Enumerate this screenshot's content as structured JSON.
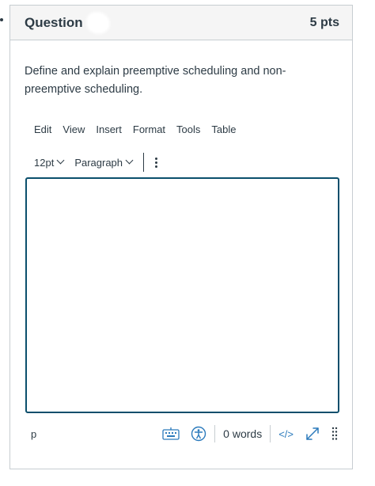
{
  "question": {
    "title": "Question",
    "points": "5 pts",
    "text": "Define and explain preemptive scheduling and non-preemptive scheduling."
  },
  "editor": {
    "menubar": [
      "Edit",
      "View",
      "Insert",
      "Format",
      "Tools",
      "Table"
    ],
    "toolbar": {
      "font_size": "12pt",
      "block_format": "Paragraph",
      "more_icon": "kebab-icon"
    },
    "content": "",
    "statusbar": {
      "path": "p",
      "word_count": "0 words",
      "html_toggle": "</>",
      "icons": [
        "keyboard-icon",
        "accessibility-icon",
        "fullscreen-icon",
        "resize-handle-icon"
      ]
    }
  },
  "colors": {
    "accent": "#0b4f6c",
    "icon_blue": "#2b7abc",
    "text": "#2d3b45",
    "border": "#c7cdd1",
    "header_bg": "#f5f5f5"
  }
}
